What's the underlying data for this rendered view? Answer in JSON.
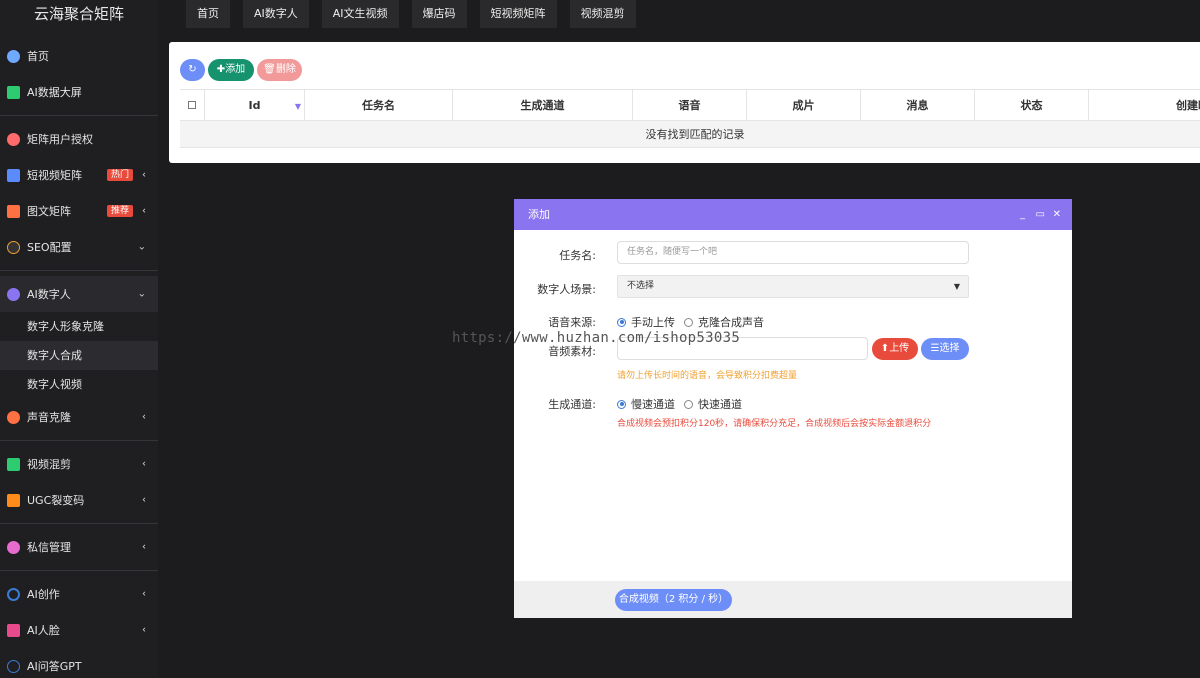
{
  "brand": "云海聚合矩阵",
  "top_tabs": [
    "首页",
    "AI数字人",
    "AI文生视频",
    "爆店码",
    "短视频矩阵",
    "视频混剪"
  ],
  "sidebar": {
    "items": [
      {
        "label": "首页",
        "icon": "pie-chart-icon",
        "color": "#6fa8ff"
      },
      {
        "label": "AI数据大屏",
        "icon": "dashboard-icon",
        "color": "#2ecc71"
      },
      {
        "label": "矩阵用户授权",
        "icon": "user-auth-icon",
        "color": "#ff6b6b"
      },
      {
        "label": "短视频矩阵",
        "icon": "video-matrix-icon",
        "color": "#5b8cff",
        "badge": "热门"
      },
      {
        "label": "图文矩阵",
        "icon": "image-text-icon",
        "color": "#ff7043",
        "badge": "推荐"
      },
      {
        "label": "SEO配置",
        "icon": "seo-icon",
        "color": "#f0a030"
      },
      {
        "label": "AI数字人",
        "icon": "digital-human-icon",
        "color": "#8a74f0"
      },
      {
        "label": "声音克隆",
        "icon": "voice-clone-icon",
        "color": "#ff7043"
      },
      {
        "label": "视频混剪",
        "icon": "video-edit-icon",
        "color": "#2ecc71"
      },
      {
        "label": "UGC裂变码",
        "icon": "qr-code-icon",
        "color": "#ff8c1a"
      },
      {
        "label": "私信管理",
        "icon": "message-icon",
        "color": "#e86bd0"
      },
      {
        "label": "AI创作",
        "icon": "ai-create-icon",
        "color": "#3a7bd5"
      },
      {
        "label": "AI人脸",
        "icon": "ai-face-icon",
        "color": "#e84b8c"
      },
      {
        "label": "AI问答GPT",
        "icon": "ai-gpt-icon",
        "color": "#3a7bd5"
      }
    ],
    "submenu": [
      "数字人形象克隆",
      "数字人合成",
      "数字人视频"
    ]
  },
  "toolbar": {
    "add": "添加",
    "delete": "删除"
  },
  "table": {
    "columns": [
      "Id",
      "任务名",
      "生成通道",
      "语音",
      "成片",
      "消息",
      "状态",
      "创建时"
    ],
    "empty": "没有找到匹配的记录"
  },
  "modal": {
    "title": "添加",
    "task_label": "任务名:",
    "task_placeholder": "任务名，随便写一个吧",
    "scene_label": "数字人场景:",
    "scene_value": "不选择",
    "voice_label": "语音来源:",
    "voice_opt1": "手动上传",
    "voice_opt2": "克隆合成声音",
    "audio_label": "音频素材:",
    "upload": "上传",
    "choose": "选择",
    "audio_note": "请勿上传长时间的语音，会导致积分扣费超量",
    "channel_label": "生成通道:",
    "channel_opt1": "慢速通道",
    "channel_opt2": "快速通道",
    "channel_note": "合成视频会预扣积分120秒，请确保积分充足，合成视频后会按实际金额退积分",
    "submit": "合成视频（2 积分 / 秒）"
  },
  "watermark": "https://www.huzhan.com/ishop53035"
}
